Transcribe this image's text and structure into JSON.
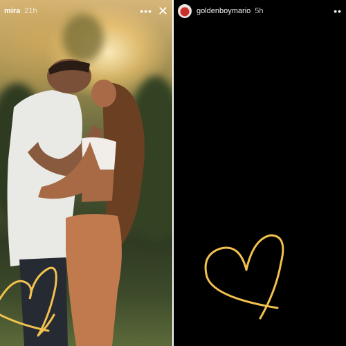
{
  "left_story": {
    "username": "mira",
    "time": "21h",
    "more_icon": "more-horizontal-icon",
    "close_icon": "close-icon",
    "sticker_icon": "heart-sticker-icon"
  },
  "right_story": {
    "username": "goldenboymario",
    "time": "5h",
    "more_icon": "more-horizontal-icon",
    "sticker_icon": "heart-sticker-icon"
  },
  "colors": {
    "heart_sticker": "#f2c14e",
    "right_background": "#000000"
  }
}
